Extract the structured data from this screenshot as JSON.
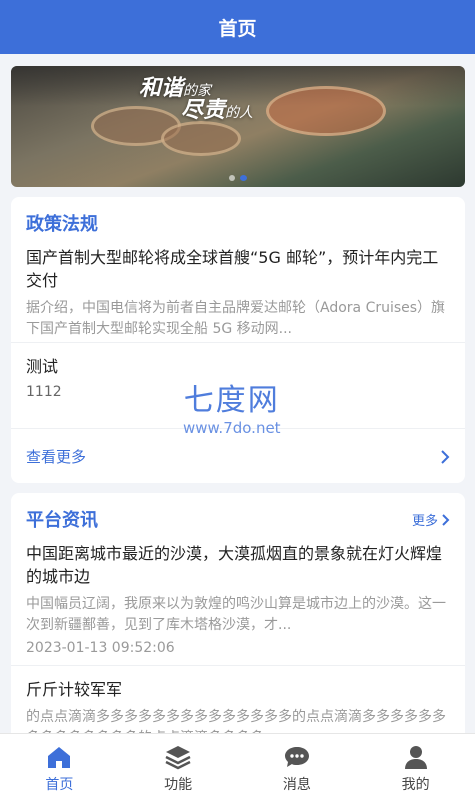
{
  "header": {
    "title": "首页"
  },
  "banner": {
    "line1_big": "和谐",
    "line1_small": "的家",
    "line2_big": "尽责",
    "line2_small": "的人"
  },
  "policy": {
    "title": "政策法规",
    "items": [
      {
        "title": "国产首制大型邮轮将成全球首艘“5G 邮轮”，预计年内完工交付",
        "desc": "据介绍，中国电信将为前者自主品牌爱达邮轮（Adora Cruises）旗下国产首制大型邮轮实现全船 5G 移动网..."
      },
      {
        "title": "测试",
        "meta": "1112"
      }
    ],
    "more_label": "查看更多"
  },
  "watermark": {
    "big": "七度网",
    "small": "www.7do.net"
  },
  "news": {
    "title": "平台资讯",
    "more_label": "更多",
    "items": [
      {
        "title": "中国距离城市最近的沙漠，大漠孤烟直的景象就在灯火辉煌的城市边",
        "desc": "中国幅员辽阔，我原来以为敦煌的鸣沙山算是城市边上的沙漠。这一次到新疆鄯善，见到了库木塔格沙漠，才...",
        "time": "2023-01-13 09:52:06"
      },
      {
        "title": "斤斤计较军军",
        "desc": "的点点滴滴多多多多多多多多多多多多多多的点点滴滴多多多多多多多多多多多多多多的点点滴滴多多多多"
      }
    ]
  },
  "tabbar": {
    "tabs": [
      {
        "label": "首页",
        "icon": "home-icon"
      },
      {
        "label": "功能",
        "icon": "layers-icon"
      },
      {
        "label": "消息",
        "icon": "chat-icon"
      },
      {
        "label": "我的",
        "icon": "user-icon"
      }
    ]
  },
  "colors": {
    "primary": "#3d6fd9",
    "background": "#f2f4f8"
  }
}
